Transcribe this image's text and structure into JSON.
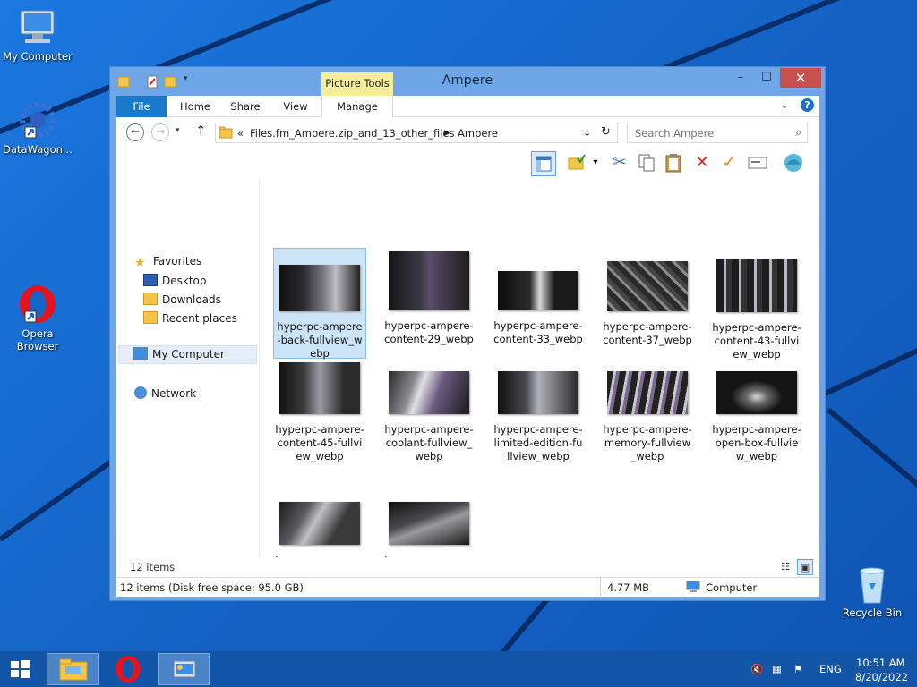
{
  "desktop": {
    "icons": [
      {
        "label": "My Computer"
      },
      {
        "label": "DataWagon..."
      },
      {
        "label": "Opera Browser"
      },
      {
        "label": "Recycle Bin"
      }
    ]
  },
  "window": {
    "title": "Ampere",
    "context_tab": "Picture Tools",
    "tabs": [
      "File",
      "Home",
      "Share",
      "View",
      "Manage"
    ],
    "address": {
      "prefix": "«",
      "segments": [
        "Files.fm_Ampere.zip_and_13_other_files",
        "Ampere"
      ]
    },
    "search_placeholder": "Search Ampere",
    "navigation": {
      "favorites": "Favorites",
      "favorites_items": [
        "Desktop",
        "Downloads",
        "Recent places"
      ],
      "computer": "My Computer",
      "network": "Network"
    },
    "files": [
      "hyperpc-ampere-back-fullview_webp",
      "hyperpc-ampere-content-29_webp",
      "hyperpc-ampere-content-33_webp",
      "hyperpc-ampere-content-37_webp",
      "hyperpc-ampere-content-43-fullview_webp",
      "hyperpc-ampere-content-45-fullview_webp",
      "hyperpc-ampere-coolant-fullview_webp",
      "hyperpc-ampere-limited-edition-fullview_webp",
      "hyperpc-ampere-memory-fullview_webp",
      "hyperpc-ampere-open-box-fullview_webp",
      "hyperpc-ampere-ports-fullview_webp",
      "hyperpc-ampere-table-fullview_webp"
    ],
    "item_count": "12 items",
    "status": {
      "left": "12 items (Disk free space: 95.0 GB)",
      "size": "4.77 MB",
      "location": "Computer"
    }
  },
  "taskbar": {
    "language": "ENG",
    "time": "10:51 AM",
    "date": "8/20/2022"
  },
  "colors": {
    "accent": "#1979ca",
    "close": "#c7504f",
    "picture_tools": "#f6ee9b"
  }
}
